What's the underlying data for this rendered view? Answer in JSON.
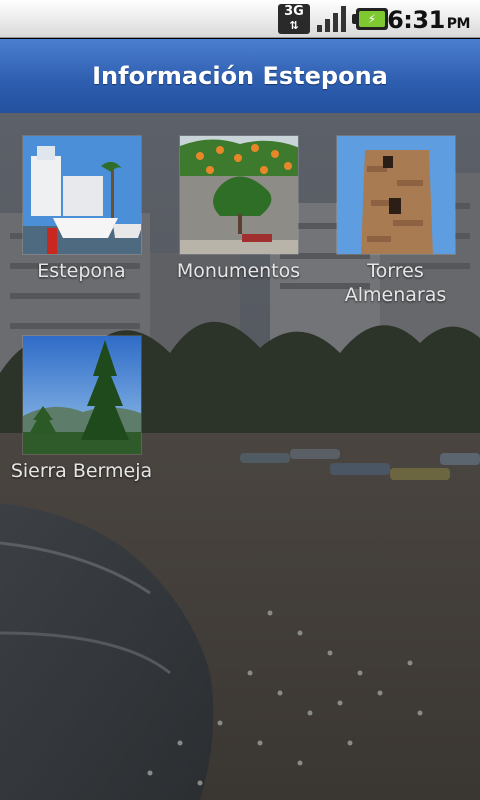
{
  "status_bar": {
    "network": "3G",
    "time": "6:31",
    "ampm": "PM"
  },
  "header": {
    "title": "Información Estepona"
  },
  "grid_items": [
    {
      "label": "Estepona"
    },
    {
      "label": "Monumentos"
    },
    {
      "label": "Torres Almenaras"
    },
    {
      "label": "Sierra Bermeja"
    }
  ]
}
